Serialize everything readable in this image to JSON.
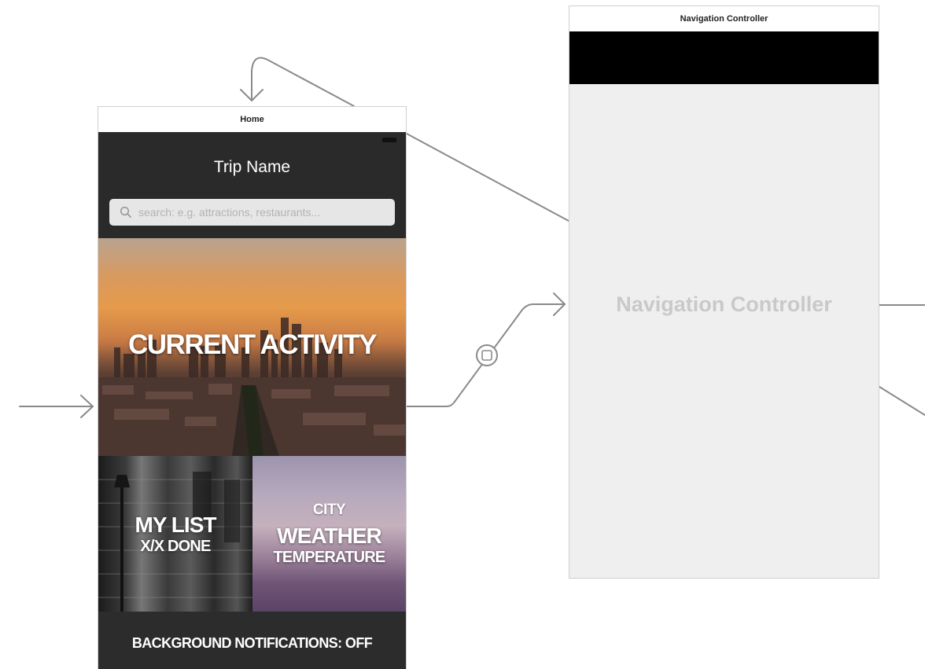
{
  "home_scene": {
    "title": "Home",
    "nav_title": "Trip Name",
    "search": {
      "placeholder": "search: e.g. attractions, restaurants..."
    },
    "tiles": {
      "current_activity": "CURRENT ACTIVITY",
      "my_list": {
        "title": "MY LIST",
        "subtitle": "X/X DONE"
      },
      "weather": {
        "city": "CITY",
        "title": "WEATHER",
        "subtitle": "TEMPERATURE"
      }
    },
    "notifications_label": "BACKGROUND NOTIFICATIONS: OFF"
  },
  "navigation_controller_scene": {
    "title": "Navigation Controller",
    "placeholder_label": "Navigation Controller"
  },
  "colors": {
    "connector": "#8a8a8a",
    "home_dark": "#2a2a2a",
    "nav_bar": "#000000",
    "nav_body": "#efefef",
    "placeholder_text": "#c9c9c9"
  },
  "icons": [
    "search-icon",
    "segue-icon",
    "arrow-icon"
  ]
}
